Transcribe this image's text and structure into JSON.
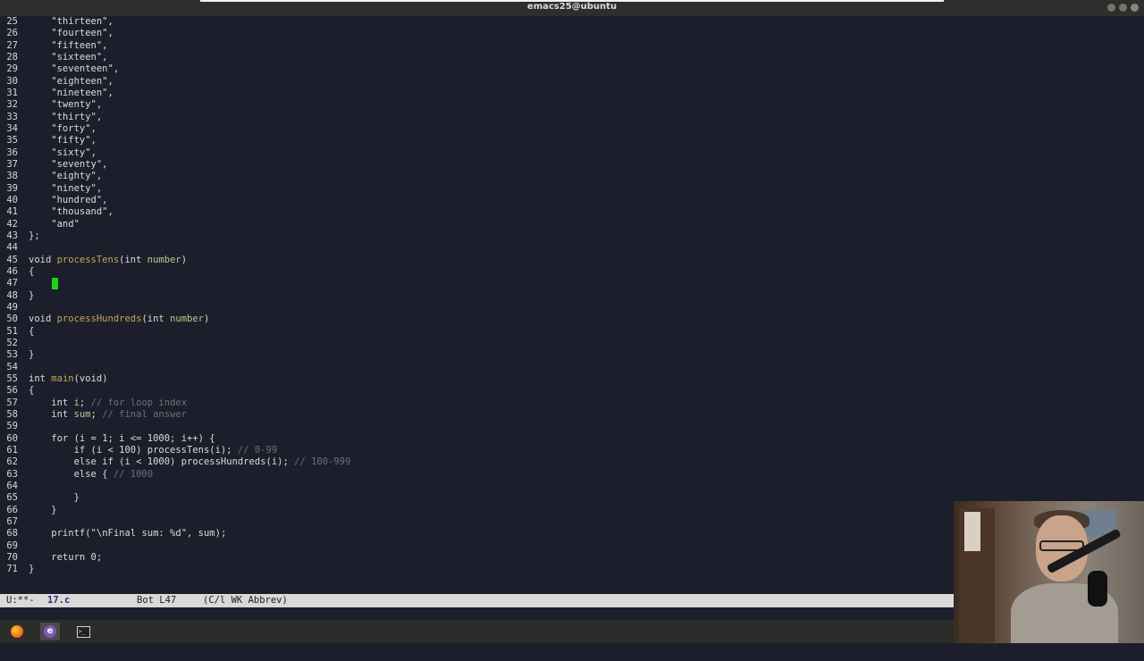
{
  "window": {
    "title": "emacs25@ubuntu"
  },
  "editor": {
    "cursor_line": "47",
    "lines": [
      {
        "n": "25",
        "t": [
          [
            "str",
            "    \"thirteen\","
          ]
        ]
      },
      {
        "n": "26",
        "t": [
          [
            "str",
            "    \"fourteen\","
          ]
        ]
      },
      {
        "n": "27",
        "t": [
          [
            "str",
            "    \"fifteen\","
          ]
        ]
      },
      {
        "n": "28",
        "t": [
          [
            "str",
            "    \"sixteen\","
          ]
        ]
      },
      {
        "n": "29",
        "t": [
          [
            "str",
            "    \"seventeen\","
          ]
        ]
      },
      {
        "n": "30",
        "t": [
          [
            "str",
            "    \"eighteen\","
          ]
        ]
      },
      {
        "n": "31",
        "t": [
          [
            "str",
            "    \"nineteen\","
          ]
        ]
      },
      {
        "n": "32",
        "t": [
          [
            "str",
            "    \"twenty\","
          ]
        ]
      },
      {
        "n": "33",
        "t": [
          [
            "str",
            "    \"thirty\","
          ]
        ]
      },
      {
        "n": "34",
        "t": [
          [
            "str",
            "    \"forty\","
          ]
        ]
      },
      {
        "n": "35",
        "t": [
          [
            "str",
            "    \"fifty\","
          ]
        ]
      },
      {
        "n": "36",
        "t": [
          [
            "str",
            "    \"sixty\","
          ]
        ]
      },
      {
        "n": "37",
        "t": [
          [
            "str",
            "    \"seventy\","
          ]
        ]
      },
      {
        "n": "38",
        "t": [
          [
            "str",
            "    \"eighty\","
          ]
        ]
      },
      {
        "n": "39",
        "t": [
          [
            "str",
            "    \"ninety\","
          ]
        ]
      },
      {
        "n": "40",
        "t": [
          [
            "str",
            "    \"hundred\","
          ]
        ]
      },
      {
        "n": "41",
        "t": [
          [
            "str",
            "    \"thousand\","
          ]
        ]
      },
      {
        "n": "42",
        "t": [
          [
            "str",
            "    \"and\""
          ]
        ]
      },
      {
        "n": "43",
        "t": [
          [
            "tx",
            "};"
          ]
        ]
      },
      {
        "n": "44",
        "t": []
      },
      {
        "n": "45",
        "t": [
          [
            "kw",
            "void "
          ],
          [
            "fn",
            "processTens"
          ],
          [
            "tx",
            "("
          ],
          [
            "kw",
            "int "
          ],
          [
            "var",
            "number"
          ],
          [
            "tx",
            ")"
          ]
        ]
      },
      {
        "n": "46",
        "t": [
          [
            "tx",
            "{"
          ]
        ]
      },
      {
        "n": "47",
        "t": []
      },
      {
        "n": "48",
        "t": [
          [
            "tx",
            "}"
          ]
        ]
      },
      {
        "n": "49",
        "t": []
      },
      {
        "n": "50",
        "t": [
          [
            "kw",
            "void "
          ],
          [
            "fn",
            "processHundreds"
          ],
          [
            "tx",
            "("
          ],
          [
            "kw",
            "int "
          ],
          [
            "var",
            "number"
          ],
          [
            "tx",
            ")"
          ]
        ]
      },
      {
        "n": "51",
        "t": [
          [
            "tx",
            "{"
          ]
        ]
      },
      {
        "n": "52",
        "t": []
      },
      {
        "n": "53",
        "t": [
          [
            "tx",
            "}"
          ]
        ]
      },
      {
        "n": "54",
        "t": []
      },
      {
        "n": "55",
        "t": [
          [
            "kw",
            "int "
          ],
          [
            "fn",
            "main"
          ],
          [
            "tx",
            "("
          ],
          [
            "kw",
            "void"
          ],
          [
            "tx",
            ")"
          ]
        ]
      },
      {
        "n": "56",
        "t": [
          [
            "tx",
            "{"
          ]
        ]
      },
      {
        "n": "57",
        "t": [
          [
            "kw",
            "    int "
          ],
          [
            "var",
            "i"
          ],
          [
            "tx",
            "; "
          ],
          [
            "cm",
            "// for loop index"
          ]
        ]
      },
      {
        "n": "58",
        "t": [
          [
            "kw",
            "    int "
          ],
          [
            "var",
            "sum"
          ],
          [
            "tx",
            "; "
          ],
          [
            "cm",
            "// final answer"
          ]
        ]
      },
      {
        "n": "59",
        "t": []
      },
      {
        "n": "60",
        "t": [
          [
            "kw",
            "    for"
          ],
          [
            "tx",
            " (i = 1; i <= 1000; i++) {"
          ]
        ]
      },
      {
        "n": "61",
        "t": [
          [
            "kw",
            "        if"
          ],
          [
            "tx",
            " (i < 100) processTens(i); "
          ],
          [
            "cm",
            "// 0-99"
          ]
        ]
      },
      {
        "n": "62",
        "t": [
          [
            "kw",
            "        else if"
          ],
          [
            "tx",
            " (i < 1000) processHundreds(i); "
          ],
          [
            "cm",
            "// 100-999"
          ]
        ]
      },
      {
        "n": "63",
        "t": [
          [
            "kw",
            "        else"
          ],
          [
            "tx",
            " { "
          ],
          [
            "cm",
            "// 1000"
          ]
        ]
      },
      {
        "n": "64",
        "t": []
      },
      {
        "n": "65",
        "t": [
          [
            "tx",
            "        }"
          ]
        ]
      },
      {
        "n": "66",
        "t": [
          [
            "tx",
            "    }"
          ]
        ]
      },
      {
        "n": "67",
        "t": []
      },
      {
        "n": "68",
        "t": [
          [
            "tx",
            "    printf("
          ],
          [
            "str",
            "\"\\nFinal sum: %d\""
          ],
          [
            "tx",
            ", sum);"
          ]
        ]
      },
      {
        "n": "69",
        "t": []
      },
      {
        "n": "70",
        "t": [
          [
            "kw",
            "    return"
          ],
          [
            "tx",
            " 0;"
          ]
        ]
      },
      {
        "n": "71",
        "t": [
          [
            "tx",
            "}"
          ]
        ]
      }
    ]
  },
  "modeline": {
    "status": "U:**-",
    "buffer": "17.c",
    "position": "Bot L47",
    "modes": "(C/l WK Abbrev)"
  },
  "taskbar": {
    "items": [
      {
        "name": "firefox-icon",
        "active": false
      },
      {
        "name": "emacs-icon",
        "active": true
      },
      {
        "name": "terminal-icon",
        "active": false
      }
    ]
  },
  "colors": {
    "background": "#1c1f2b",
    "function": "#c8a35a",
    "variable": "#b9c98f",
    "comment": "#6d7079",
    "cursor": "#1dd21d",
    "modeline": "#d9d9d7"
  }
}
